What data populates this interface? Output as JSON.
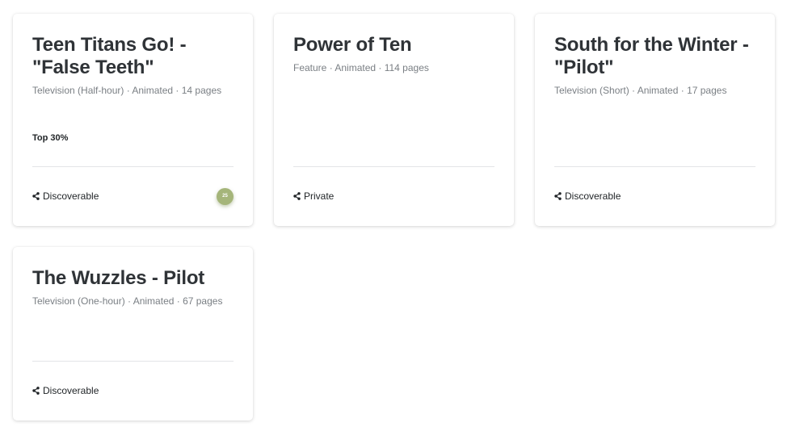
{
  "projects": [
    {
      "title": "Teen Titans Go! - \"False Teeth\"",
      "meta": "Television (Half-hour) · Animated · 14 pages",
      "rank": "Top 30%",
      "visibility": "Discoverable",
      "score": "25",
      "score_color": "#a5b57a"
    },
    {
      "title": "Power of Ten",
      "meta": "Feature · Animated · 114 pages",
      "visibility": "Private"
    },
    {
      "title": "South for the Winter - \"Pilot\"",
      "meta": "Television (Short) · Animated · 17 pages",
      "visibility": "Discoverable"
    },
    {
      "title": "The Wuzzles - Pilot",
      "meta": "Television (One-hour) · Animated · 67 pages",
      "visibility": "Discoverable"
    }
  ],
  "icons": {
    "visibility": "share-icon"
  }
}
